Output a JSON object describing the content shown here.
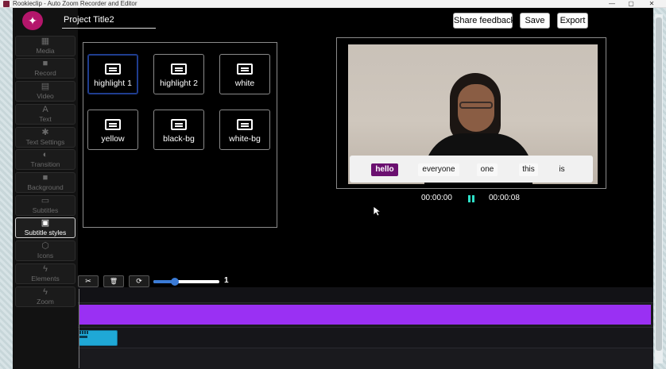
{
  "window": {
    "title": "Rookieclip - Auto Zoom Recorder and Editor",
    "minimize_glyph": "—",
    "maximize_glyph": "▢",
    "close_glyph": "✕"
  },
  "sidebar": {
    "logo_icon": "sparkle-logo-icon",
    "items": [
      {
        "label": "Media",
        "icon": "image-icon",
        "glyph": "▦"
      },
      {
        "label": "Record",
        "icon": "camera-icon",
        "glyph": "■"
      },
      {
        "label": "Video",
        "icon": "clapperboard-icon",
        "glyph": "▤"
      },
      {
        "label": "Text",
        "icon": "text-icon",
        "glyph": "A"
      },
      {
        "label": "Text Settings",
        "icon": "gear-icon",
        "glyph": "✱"
      },
      {
        "label": "Transition",
        "icon": "transition-icon",
        "glyph": "◐"
      },
      {
        "label": "Background",
        "icon": "background-icon",
        "glyph": "■"
      },
      {
        "label": "Subtitles",
        "icon": "closed-caption-icon",
        "glyph": "▭"
      },
      {
        "label": "Subtitle styles",
        "icon": "subtitle-style-icon",
        "glyph": "▣"
      },
      {
        "label": "Icons",
        "icon": "shapes-icon",
        "glyph": "⬡"
      },
      {
        "label": "Elements",
        "icon": "bolt-icon",
        "glyph": "ϟ"
      },
      {
        "label": "Zoom",
        "icon": "bolt-icon",
        "glyph": "ϟ"
      }
    ],
    "active_index": 8
  },
  "header": {
    "project_title": "Project Title2",
    "share_feedback_label": "Share feedback",
    "save_label": "Save",
    "export_label": "Export"
  },
  "subtitle_styles": [
    {
      "label": "highlight 1",
      "selected": true
    },
    {
      "label": "highlight 2",
      "selected": false
    },
    {
      "label": "white",
      "selected": false
    },
    {
      "label": "yellow",
      "selected": false
    },
    {
      "label": "black-bg",
      "selected": false
    },
    {
      "label": "white-bg",
      "selected": false
    }
  ],
  "preview": {
    "caption_words": [
      "hello",
      "everyone",
      "one",
      "this",
      "is"
    ],
    "highlighted_word_index": 0,
    "highlight_color": "#6b1070",
    "current_time": "00:00:00",
    "end_time": "00:00:08",
    "pause_color": "#2ee0c8"
  },
  "timeline_toolbar": {
    "cut_glyph": "✂",
    "delete_glyph": "🗑",
    "loop_glyph": "⟳",
    "zoom_value": "1",
    "zoom_fraction": 0.33
  },
  "timeline": {
    "main_track_color": "#9a30f3",
    "subtitle_clip_color": "#1fa8d6"
  }
}
